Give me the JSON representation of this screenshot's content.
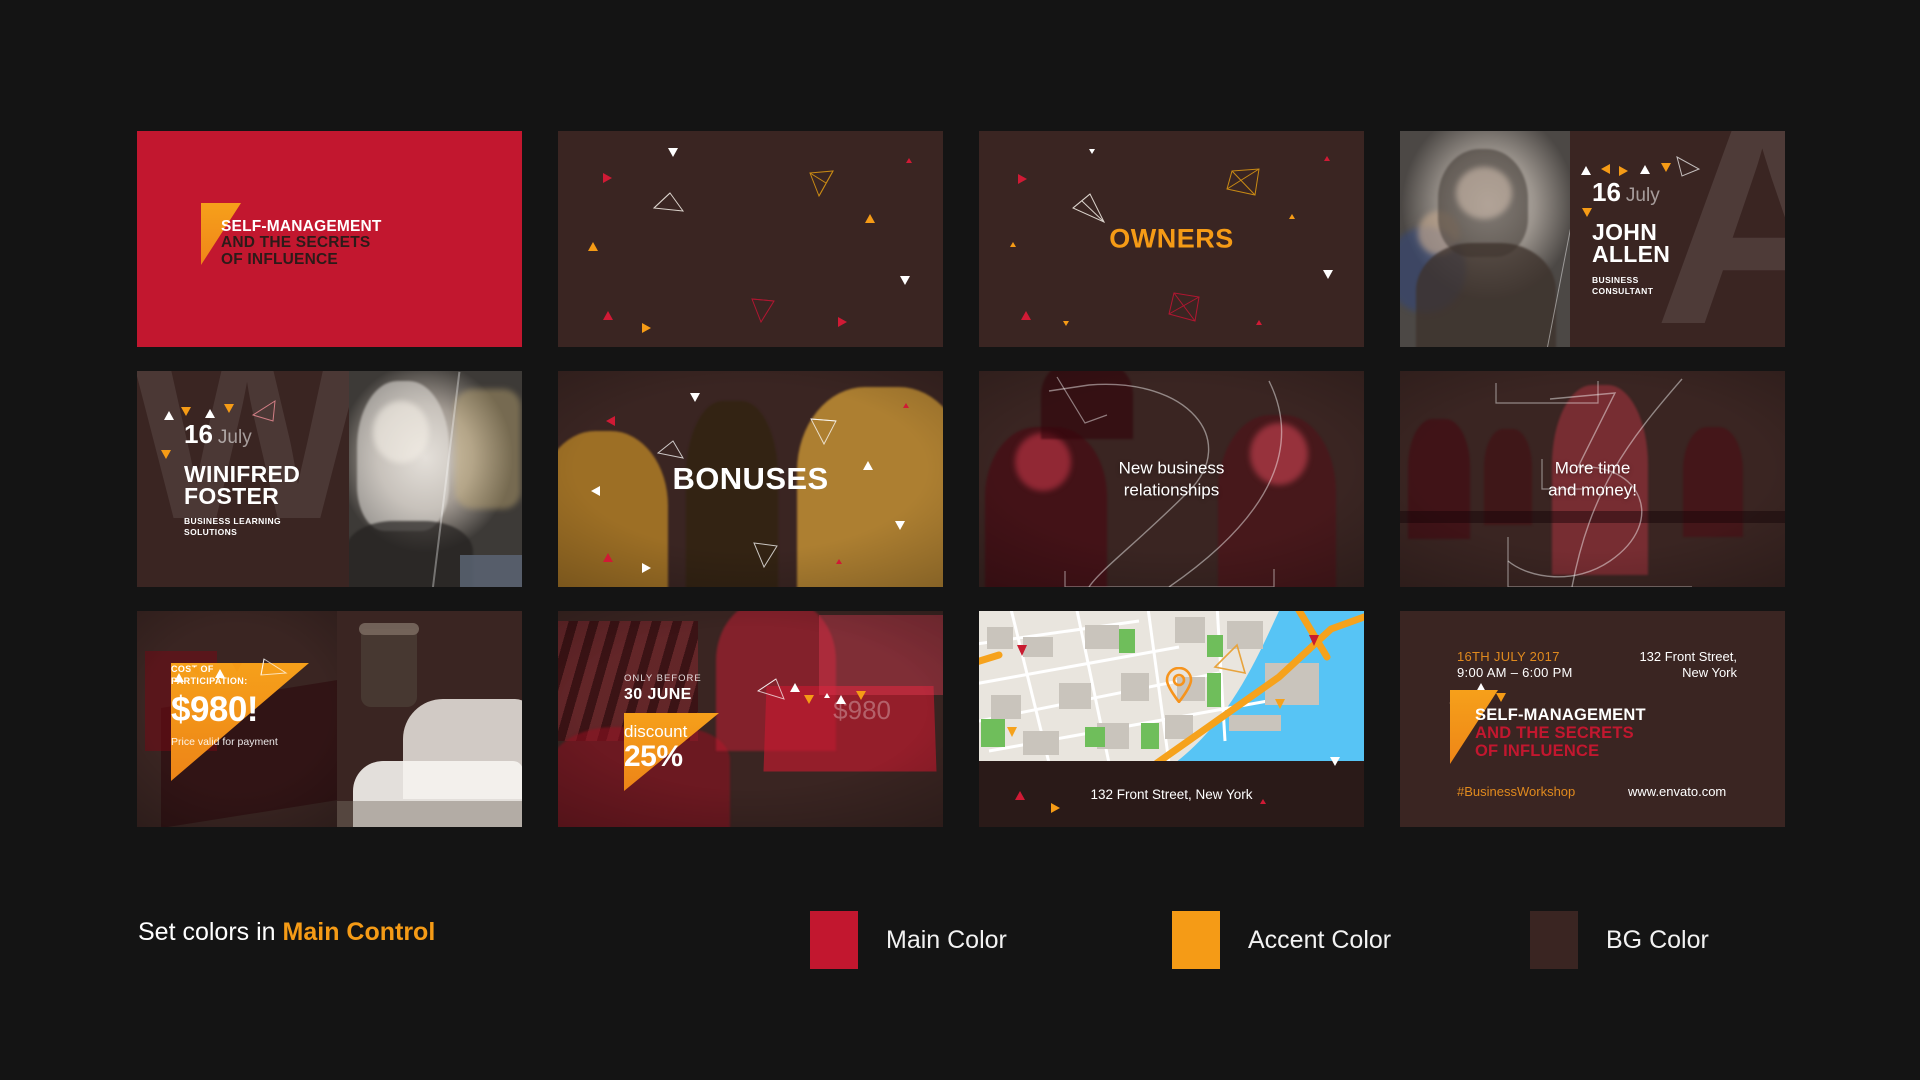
{
  "page": {
    "background": "#141414"
  },
  "palette": {
    "main": "#C2172F",
    "accent": "#F59B16",
    "bg": "#3A2522",
    "white": "#FFFFFF"
  },
  "cards": {
    "title_slide": {
      "line1": "SELF-MANAGEMENT",
      "line2": "AND THE SECRETS",
      "line3": "OF INFLUENCE"
    },
    "particles_blank": {
      "label": ""
    },
    "owners": {
      "word": "OWNERS"
    },
    "speaker_john": {
      "day": "16",
      "month": "July",
      "first_name": "JOHN",
      "last_name": "ALLEN",
      "role_line1": "BUSINESS",
      "role_line2": "CONSULTANT",
      "big_letter": "A"
    },
    "speaker_winifred": {
      "day": "16",
      "month": "July",
      "first_name": "WINIFRED",
      "last_name": "FOSTER",
      "role_line1": "BUSINESS LEARNING",
      "role_line2": "SOLUTIONS",
      "big_letter": "W"
    },
    "bonuses": {
      "word": "BONUSES"
    },
    "benefit_one": {
      "caption": "New business\nrelationships",
      "big_numeral": "2"
    },
    "benefit_two": {
      "caption": "More time\nand money!",
      "big_numeral": "3"
    },
    "price": {
      "kicker_line1": "COST OF",
      "kicker_line2": "PARTICIPATION:",
      "amount": "$980!",
      "note": "Price valid for payment"
    },
    "discount": {
      "kicker": "ONLY BEFORE",
      "date": "30 JUNE",
      "word": "discount",
      "percent": "25%",
      "old_price": "$980"
    },
    "map": {
      "address": "132 Front Street, New York",
      "pin_icon": "map-pin-icon"
    },
    "info": {
      "date": "16TH JULY 2017",
      "time": "9:00 AM – 6:00 PM",
      "address": "132 Front Street,\nNew York",
      "title_line1": "SELF-MANAGEMENT",
      "title_line2": "AND THE SECRETS",
      "title_line3": "OF INFLUENCE",
      "hashtag": "#BusinessWorkshop",
      "url": "www.envato.com"
    }
  },
  "legend": {
    "note_prefix": "Set colors in ",
    "note_strong": "Main Control",
    "swatches": [
      {
        "label": "Main Color",
        "color": "#C2172F"
      },
      {
        "label": "Accent Color",
        "color": "#F59B16"
      },
      {
        "label": "BG Color",
        "color": "#3A2522"
      }
    ]
  }
}
